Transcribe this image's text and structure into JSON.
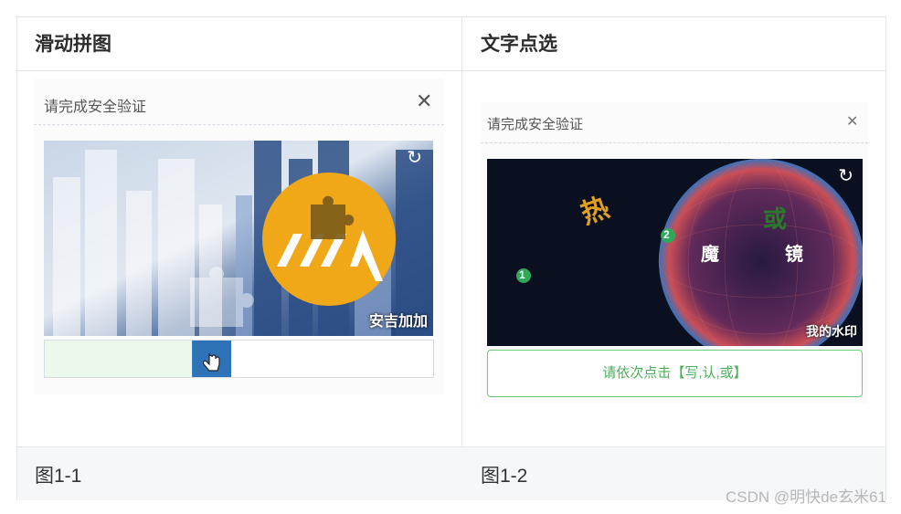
{
  "header": {
    "col1": "滑动拼图",
    "col2": "文字点选"
  },
  "footer": {
    "col1": "图1-1",
    "col2": "图1-2"
  },
  "slider_captcha": {
    "title": "请完成安全验证",
    "close_icon": "close-icon",
    "refresh_icon": "refresh-icon",
    "image_watermark": "安吉加加",
    "progress": 0.38
  },
  "click_captcha": {
    "title": "请完成安全验证",
    "close_icon": "close-icon",
    "refresh_icon": "refresh-icon",
    "chars": [
      "热",
      "魔",
      "镜",
      "或"
    ],
    "markers": [
      "1",
      "2"
    ],
    "image_watermark": "我的水印",
    "hint": "请依次点击【写,认,或】"
  },
  "page_watermark": "CSDN @明快de玄米61",
  "colors": {
    "accent_green": "#4cae5a",
    "slider_blue": "#2e73b8",
    "logo_orange": "#f0a818"
  }
}
